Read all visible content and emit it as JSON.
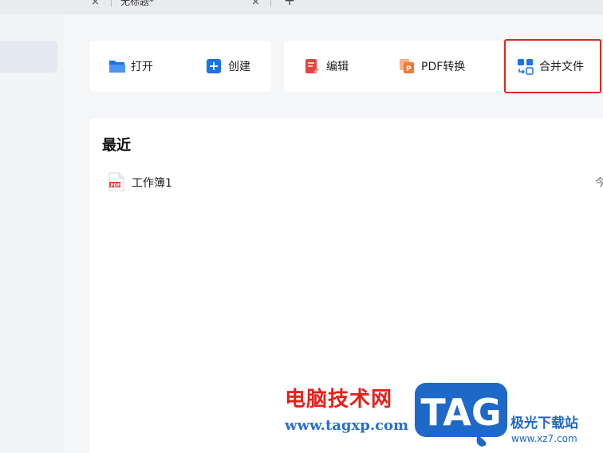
{
  "tabbar": {
    "tab_title": "无标题*",
    "close_glyph": "×",
    "new_tab_glyph": "+"
  },
  "toolbar": {
    "open_label": "打开",
    "create_label": "创建",
    "edit_label": "编辑",
    "pdf_convert_label": "PDF转换",
    "merge_label": "合并文件",
    "highlight_color": "#e0261f"
  },
  "recent": {
    "title": "最近",
    "files": [
      {
        "name": "工作簿1",
        "date": "今",
        "icon": "pdf-file-icon"
      }
    ]
  },
  "watermark": {
    "line1": "电脑技术网",
    "line2": "www.tagxp.com",
    "logo_text": "TAG",
    "line3": "极光下载站",
    "line4": "www.xz7.com"
  },
  "colors": {
    "accent_blue": "#1a73e8",
    "edit_red": "#e8433f",
    "pdf_orange": "#f07a3a",
    "watermark_red": "#e3211b",
    "watermark_blue": "#1e68c8"
  }
}
